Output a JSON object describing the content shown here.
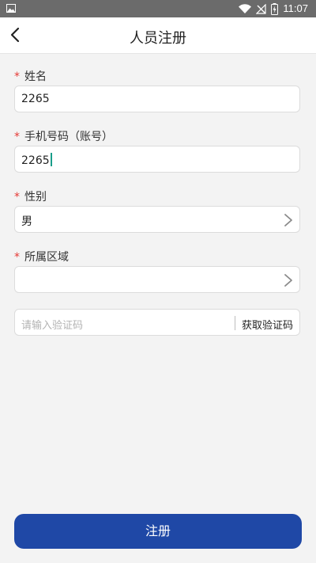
{
  "status_bar": {
    "time": "11:07",
    "icons": [
      "image-icon",
      "wifi-icon",
      "signal-off-icon",
      "battery-charging-icon"
    ]
  },
  "app_bar": {
    "title": "人员注册",
    "back_icon": "chevron-left-icon"
  },
  "form": {
    "name": {
      "label": "姓名",
      "required_mark": "*",
      "value": "2265"
    },
    "phone": {
      "label": "手机号码（账号）",
      "required_mark": "*",
      "value": "2265"
    },
    "gender": {
      "label": "性别",
      "required_mark": "*",
      "value": "男"
    },
    "region": {
      "label": "所属区域",
      "required_mark": "*",
      "value": ""
    },
    "verification": {
      "placeholder": "请输入验证码",
      "get_code_label": "获取验证码"
    }
  },
  "actions": {
    "register_label": "注册"
  },
  "colors": {
    "accent": "#1f48a6",
    "required": "#e53935",
    "cursor": "#1a9e8a"
  }
}
